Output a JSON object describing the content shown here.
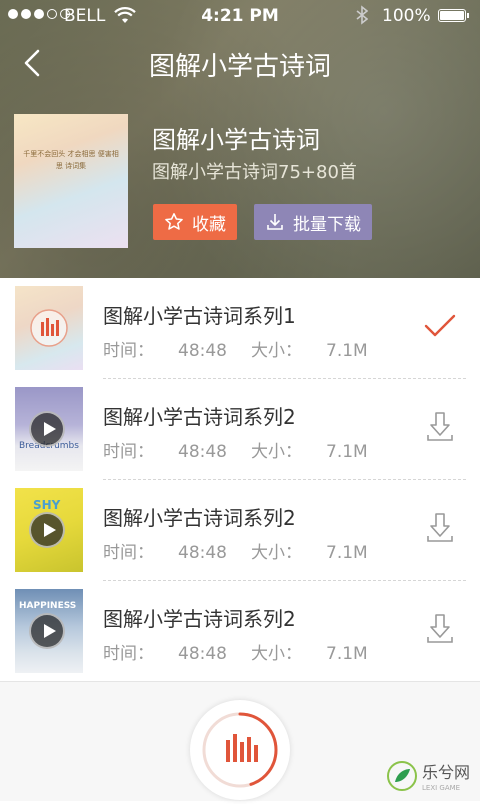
{
  "status_bar": {
    "carrier": "BELL",
    "time": "4:21 PM",
    "battery": "100%",
    "signal_filled": 3,
    "signal_total": 5
  },
  "nav": {
    "title": "图解小学古诗词",
    "back_icon": "chevron-left-icon"
  },
  "album": {
    "title": "图解小学古诗词",
    "subtitle": "图解小学古诗词75+80首",
    "cover_text": "千里不会回头 才会相思 便害相思 诗词集",
    "favorite_label": "收藏",
    "batch_download_label": "批量下载"
  },
  "tracks": [
    {
      "name": "图解小学古诗词系列1",
      "time_label": "时间：",
      "time": "48:48",
      "size_label": "大小：",
      "size": "7.1M",
      "status": "downloaded",
      "playing": true,
      "thumb_text": ""
    },
    {
      "name": "图解小学古诗词系列2",
      "time_label": "时间：",
      "time": "48:48",
      "size_label": "大小：",
      "size": "7.1M",
      "status": "download",
      "playing": false,
      "thumb_text": "Breadcrumbs"
    },
    {
      "name": "图解小学古诗词系列2",
      "time_label": "时间：",
      "time": "48:48",
      "size_label": "大小：",
      "size": "7.1M",
      "status": "download",
      "playing": false,
      "thumb_text": "SHY"
    },
    {
      "name": "图解小学古诗词系列2",
      "time_label": "时间：",
      "time": "48:48",
      "size_label": "大小：",
      "size": "7.1M",
      "status": "download",
      "playing": false,
      "thumb_text": "HAPPINESS"
    }
  ],
  "player": {
    "progress": 0.45
  },
  "watermark": {
    "text": "乐兮网",
    "sub": "LEXI GAME"
  },
  "colors": {
    "accent": "#ee6b45",
    "secondary": "#8e86b6",
    "check": "#e0553a"
  }
}
